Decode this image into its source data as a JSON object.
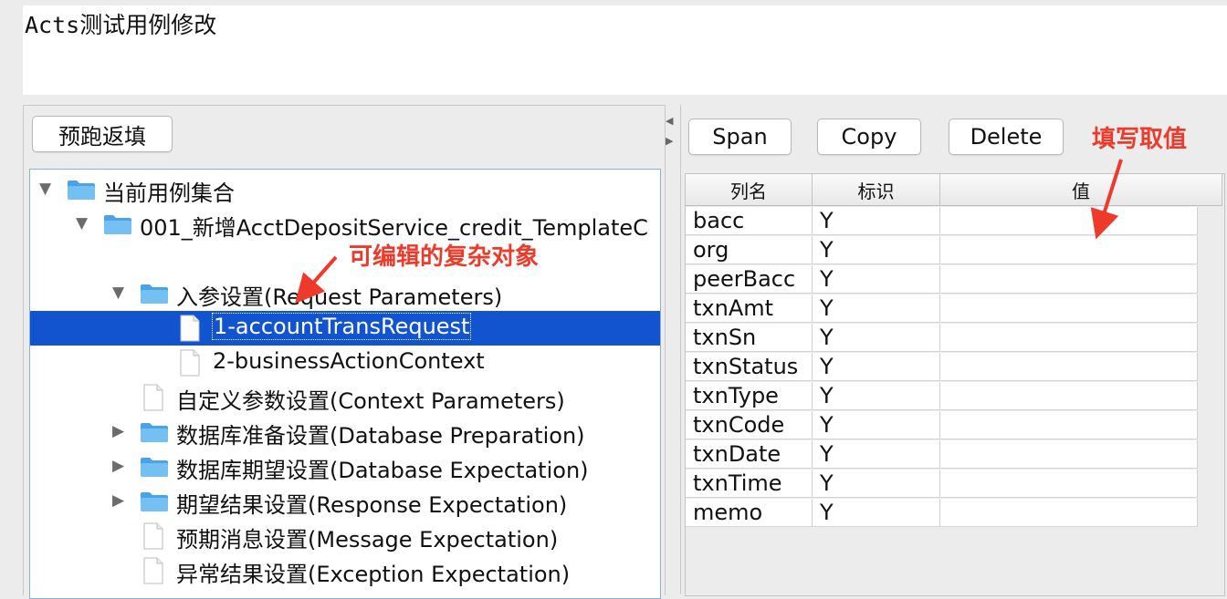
{
  "window_title": "Acts测试用例修改",
  "left": {
    "prefill_button": "预跑返填",
    "tree": [
      {
        "label": "当前用例集合",
        "kind": "folder",
        "expand": "open",
        "indent": 0
      },
      {
        "label": "001_新增AcctDepositService_credit_TemplateC",
        "kind": "folder",
        "expand": "open",
        "indent": 1
      },
      {
        "label": "入参设置(Request Parameters)",
        "kind": "folder",
        "expand": "open",
        "indent": 2
      },
      {
        "label": "1-accountTransRequest",
        "kind": "file",
        "expand": "none",
        "indent": 3,
        "selected": true
      },
      {
        "label": "2-businessActionContext",
        "kind": "file",
        "expand": "none",
        "indent": 3
      },
      {
        "label": "自定义参数设置(Context Parameters)",
        "kind": "file",
        "expand": "none",
        "indent": 2
      },
      {
        "label": "数据库准备设置(Database Preparation)",
        "kind": "folder",
        "expand": "closed",
        "indent": 2
      },
      {
        "label": "数据库期望设置(Database Expectation)",
        "kind": "folder",
        "expand": "closed",
        "indent": 2
      },
      {
        "label": "期望结果设置(Response Expectation)",
        "kind": "folder",
        "expand": "closed",
        "indent": 2
      },
      {
        "label": "预期消息设置(Message Expectation)",
        "kind": "file",
        "expand": "none",
        "indent": 2
      },
      {
        "label": "异常结果设置(Exception Expectation)",
        "kind": "file",
        "expand": "none",
        "indent": 2
      }
    ]
  },
  "right": {
    "buttons": {
      "span": "Span",
      "copy": "Copy",
      "delete": "Delete"
    },
    "table": {
      "headers": [
        "列名",
        "标识",
        "值"
      ],
      "rows": [
        [
          "bacc",
          "Y",
          ""
        ],
        [
          "org",
          "Y",
          ""
        ],
        [
          "peerBacc",
          "Y",
          ""
        ],
        [
          "txnAmt",
          "Y",
          ""
        ],
        [
          "txnSn",
          "Y",
          ""
        ],
        [
          "txnStatus",
          "Y",
          ""
        ],
        [
          "txnType",
          "Y",
          ""
        ],
        [
          "txnCode",
          "Y",
          ""
        ],
        [
          "txnDate",
          "Y",
          ""
        ],
        [
          "txnTime",
          "Y",
          ""
        ],
        [
          "memo",
          "Y",
          ""
        ]
      ]
    }
  },
  "annotations": {
    "editable_object": "可编辑的复杂对象",
    "fill_value": "填写取值"
  },
  "colors": {
    "selection": "#1254d0",
    "annotation": "#ee3a2a",
    "folder": "#5ab0ea"
  }
}
